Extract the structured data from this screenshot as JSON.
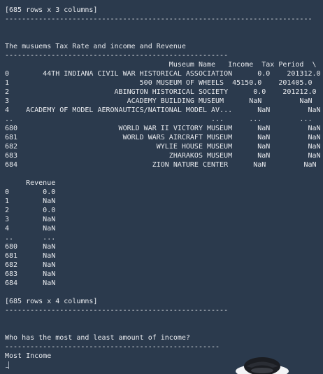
{
  "output": {
    "lines": [
      "[685 rows x 3 columns]",
      "-------------------------------------------------------------------------",
      "",
      "",
      "The musuems Tax Rate and income and Revenue",
      "-----------------------------------------------------",
      "                                       Museum Name   Income  Tax Period  \\",
      "0        44TH INDIANA CIVIL WAR HISTORICAL ASSOCIATION      0.0    201312.0",
      "1                               500 MUSEUM OF WHEELS  45150.0    201405.0",
      "2                         ABINGTON HISTORICAL SOCIETY      0.0    201212.0",
      "3                            ACADEMY BUILDING MUSEUM      NaN         NaN",
      "4    ACADEMY OF MODEL AERONAUTICS/NATIONAL MODEL AV...      NaN         NaN",
      "..                                               ...      ...         ...",
      "680                        WORLD WAR II VICTORY MUSEUM      NaN         NaN",
      "681                         WORLD WARS AIRCRAFT MUSEUM      NaN         NaN",
      "682                                 WYLIE HOUSE MUSEUM      NaN         NaN",
      "683                                    ZHARAKOS MUSEUM      NaN         NaN",
      "684                                ZION NATURE CENTER      NaN         NaN",
      "",
      "     Revenue",
      "0        0.0",
      "1        NaN",
      "2        0.0",
      "3        NaN",
      "4        NaN",
      "..       ...",
      "680      NaN",
      "681      NaN",
      "682      NaN",
      "683      NaN",
      "684      NaN",
      "",
      "[685 rows x 4 columns]",
      "-----------------------------------------------------",
      "",
      "",
      "Who has the most and least amount of income?",
      "---------------------------------------------------",
      "Most Income"
    ]
  },
  "colors": {
    "background": "#2b3a4d",
    "text": "#e8eaee"
  }
}
